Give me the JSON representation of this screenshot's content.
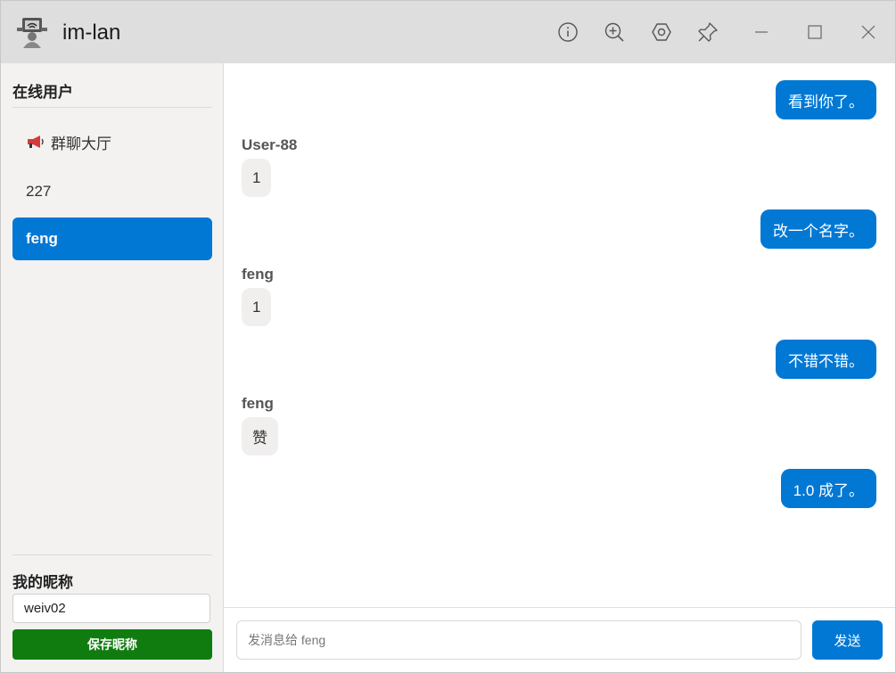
{
  "titlebar": {
    "title": "im-lan",
    "icons": [
      "app-logo",
      "info-icon",
      "zoom-in-icon",
      "settings-hexagon-icon",
      "pin-icon",
      "minimize-icon",
      "maximize-icon",
      "close-icon"
    ]
  },
  "sidebar": {
    "online_heading": "在线用户",
    "users": [
      {
        "label": "群聊大厅",
        "icon": "megaphone-icon"
      },
      {
        "label": "227"
      },
      {
        "label": "feng",
        "active": true
      }
    ],
    "nickname_heading": "我的昵称",
    "nickname_value": "weiv02",
    "save_label": "保存昵称"
  },
  "messages": [
    {
      "direction": "out",
      "text": "看到你了。"
    },
    {
      "direction": "in",
      "sender": "User-88",
      "text": "1"
    },
    {
      "direction": "out",
      "text": "改一个名字。"
    },
    {
      "direction": "in",
      "sender": "feng",
      "text": "1"
    },
    {
      "direction": "out",
      "text": "不错不错。"
    },
    {
      "direction": "in",
      "sender": "feng",
      "text": "赞"
    },
    {
      "direction": "out",
      "text": "1.0 成了。"
    }
  ],
  "composer": {
    "placeholder": "发消息给 feng",
    "send_label": "发送"
  },
  "colors": {
    "accent": "#0078d4",
    "save_green": "#107c10",
    "titlebar_bg": "#dedede",
    "sidebar_bg": "#f3f2f1"
  }
}
